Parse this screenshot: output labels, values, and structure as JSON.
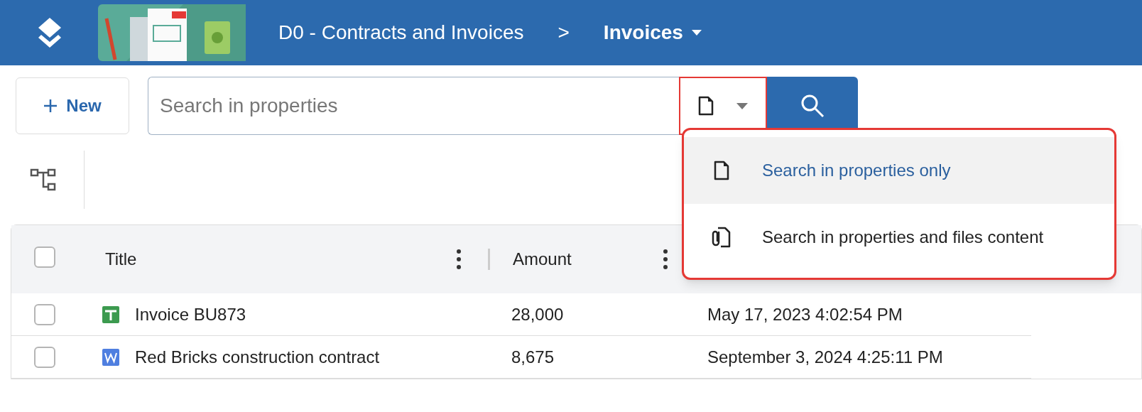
{
  "header": {
    "breadcrumb": [
      {
        "label": "D0 - Contracts and Invoices",
        "current": false
      },
      {
        "label": "Invoices",
        "current": true
      }
    ],
    "separator": ">"
  },
  "toolbar": {
    "new_button": "New",
    "search": {
      "placeholder": "Search in properties"
    },
    "scope_menu": {
      "open": true,
      "items": [
        {
          "label": "Search in properties only",
          "kind": "properties",
          "selected": true
        },
        {
          "label": "Search in properties and files content",
          "kind": "files",
          "selected": false
        }
      ]
    }
  },
  "table": {
    "columns": [
      {
        "label": "Title"
      },
      {
        "label": "Amount"
      }
    ],
    "all_checked": false,
    "rows": [
      {
        "kind": "spreadsheet",
        "title": "Invoice BU873",
        "amount": "28,000",
        "column_3": "May 17, 2023 4:02:54 PM",
        "checked": false
      },
      {
        "kind": "word",
        "title": "Red Bricks construction contract",
        "amount": "8,675",
        "column_3": "September 3, 2024 4:25:11 PM",
        "checked": false
      }
    ]
  }
}
